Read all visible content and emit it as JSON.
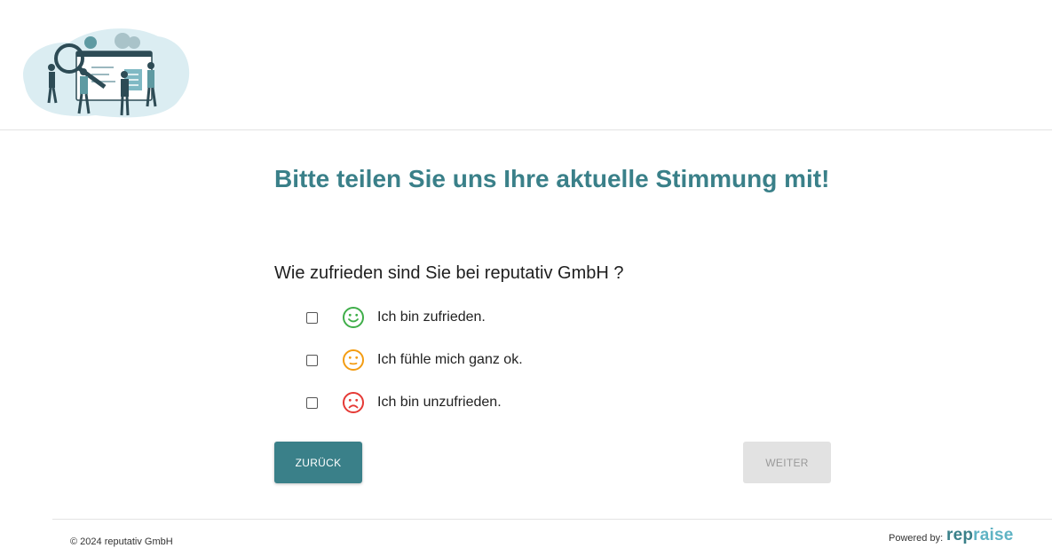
{
  "header": {
    "logo_icon": "team-analytics-illustration"
  },
  "main": {
    "title": "Bitte teilen Sie uns Ihre aktuelle Stimmung mit!",
    "question": "Wie zufrieden sind Sie bei reputativ GmbH ?",
    "options": [
      {
        "label": "Ich bin zufrieden.",
        "icon": "smiley-happy-icon",
        "color": "#3fae49",
        "checked": false
      },
      {
        "label": "Ich fühle mich ganz ok.",
        "icon": "smiley-neutral-icon",
        "color": "#f39c12",
        "checked": false
      },
      {
        "label": "Ich bin unzufrieden.",
        "icon": "smiley-sad-icon",
        "color": "#e53935",
        "checked": false
      }
    ],
    "back_label": "ZURÜCK",
    "next_label": "WEITER"
  },
  "footer": {
    "copyright": "© 2024 reputativ GmbH",
    "powered_by": "Powered by:",
    "brand_a": "rep",
    "brand_b": "raise"
  },
  "colors": {
    "accent": "#3a8089",
    "disabled": "#e2e2e2"
  }
}
